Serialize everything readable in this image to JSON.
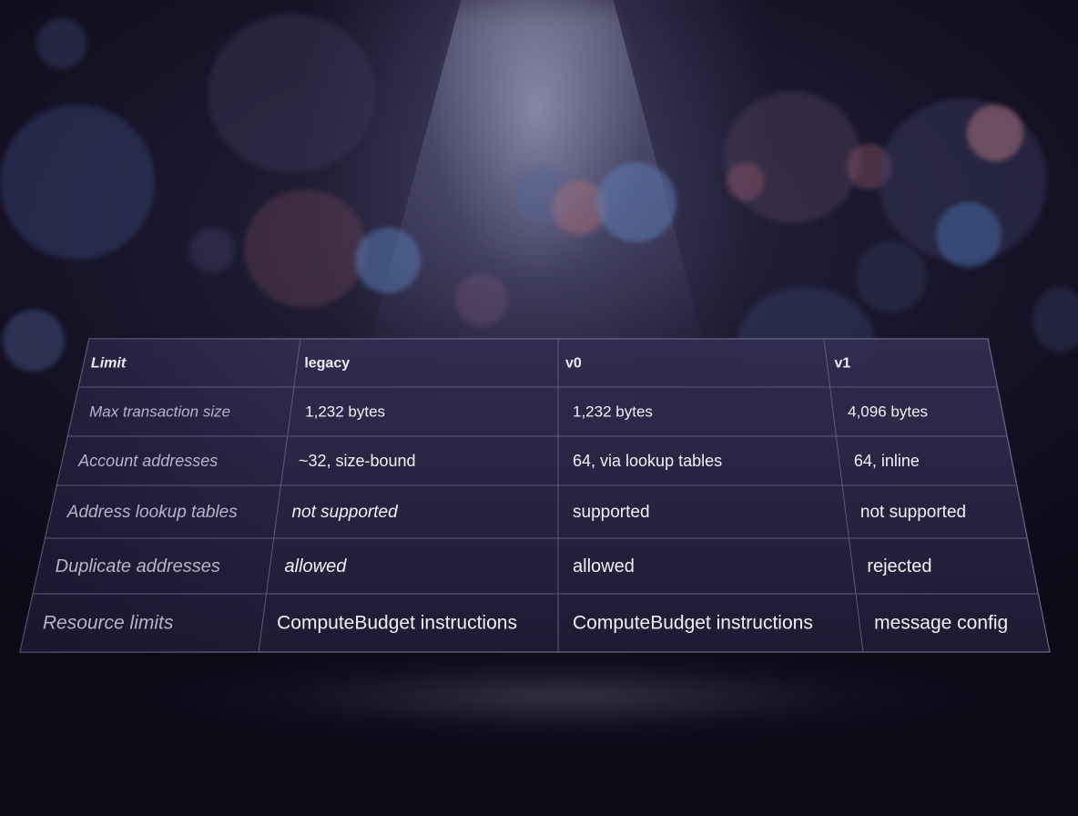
{
  "table": {
    "columns": [
      "Limit",
      "legacy",
      "v0",
      "v1"
    ],
    "rows": [
      {
        "limit": "Max transaction size",
        "legacy": "1,232 bytes",
        "v0": "1,232 bytes",
        "v1": "4,096 bytes"
      },
      {
        "limit": "Account addresses",
        "legacy": "~32, size-bound",
        "v0": "64, via lookup tables",
        "v1": "64, inline"
      },
      {
        "limit": "Address lookup tables",
        "legacy": "not supported",
        "v0": "supported",
        "v1": "not supported"
      },
      {
        "limit": "Duplicate addresses",
        "legacy": "allowed",
        "v0": "allowed",
        "v1": "rejected"
      },
      {
        "limit": "Resource limits",
        "legacy": "ComputeBudget instructions",
        "v0": "ComputeBudget instructions",
        "v1": "message config"
      }
    ]
  },
  "colors": {
    "panel": "#2a2745",
    "grid": "#5d5a7a",
    "text": "#f1f0f7",
    "label_text": "#b7b4c9"
  }
}
